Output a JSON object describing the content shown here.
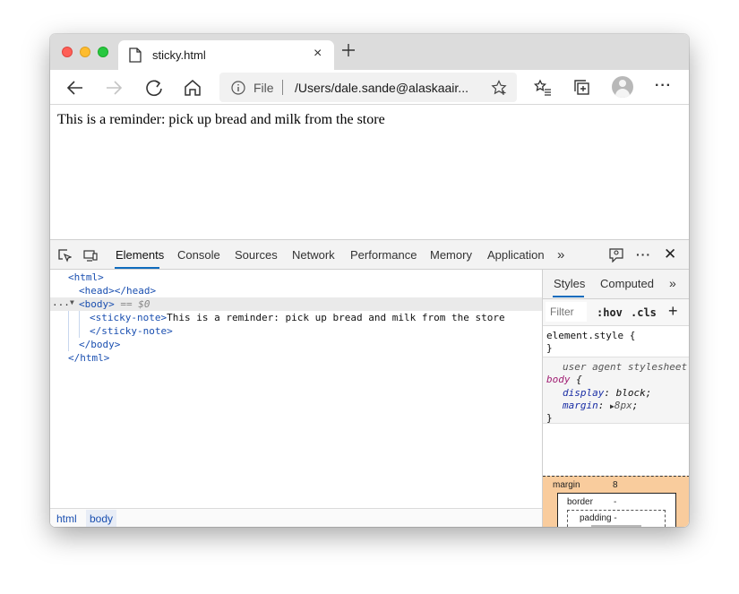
{
  "tab": {
    "title": "sticky.html",
    "close": "×"
  },
  "toolbar": {
    "scheme": "File",
    "url": "/Users/dale.sande@alaskaair..."
  },
  "page": {
    "text": "This is a reminder: pick up bread and milk from the store"
  },
  "devtools": {
    "tabs": [
      "Elements",
      "Console",
      "Sources",
      "Network",
      "Performance",
      "Memory",
      "Application"
    ],
    "active_tab": "Elements",
    "more_tabs": "»",
    "dom": {
      "html_open": "<html>",
      "head": "<head></head>",
      "body_open": "<body>",
      "body_marker": " == $0",
      "sticky_open": "<sticky-note>",
      "sticky_text": "This is a reminder: pick up bread and milk from the store",
      "sticky_close": "</sticky-note>",
      "body_close": "</body>",
      "html_close": "</html>",
      "ellipsis": "..."
    },
    "breadcrumbs": [
      "html",
      "body"
    ],
    "styles": {
      "tabs": [
        "Styles",
        "Computed"
      ],
      "more": "»",
      "filter_placeholder": "Filter",
      "hov": ":hov",
      "cls": ".cls",
      "add": "+",
      "element_style_open": "element.style {",
      "close_brace": "}",
      "ua_label": "user agent stylesheet",
      "selector": "body",
      "open_brace": " {",
      "props": [
        {
          "name": "display",
          "value": "block"
        },
        {
          "name": "margin",
          "value": "8px"
        }
      ]
    },
    "box_model": {
      "margin_label": "margin",
      "margin_value": "8",
      "border_label": "border",
      "border_value": "-",
      "padding_label": "padding -"
    }
  },
  "colors": {
    "accent": "#0f6cbd",
    "tag": "#1a4fb0",
    "selector": "#a01d72",
    "margin_box": "#f9cc9d"
  }
}
